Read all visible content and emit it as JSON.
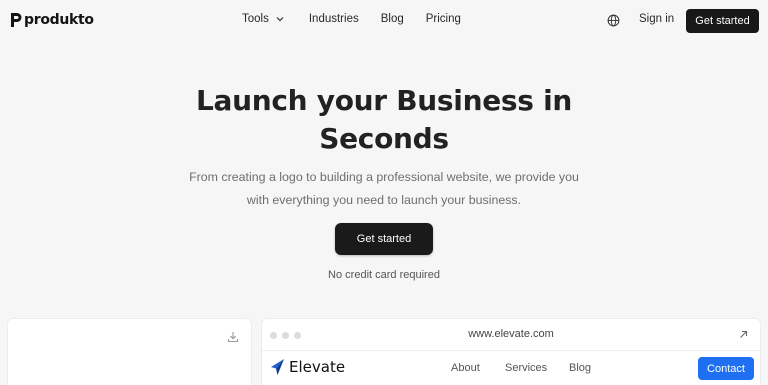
{
  "brand": {
    "name": "produkto"
  },
  "nav": {
    "links": [
      "Tools",
      "Industries",
      "Blog",
      "Pricing"
    ],
    "sign_in": "Sign in",
    "cta": "Get started"
  },
  "hero": {
    "title_line1": "Launch your Business in",
    "title_line2": "Seconds",
    "subtitle_line1": "From creating a logo to building a professional website, we provide you",
    "subtitle_line2": "with everything you need to launch your business.",
    "cta": "Get started",
    "note": "No credit card required"
  },
  "preview": {
    "url": "www.elevate.com",
    "site_name": "Elevate",
    "site_links": [
      "About",
      "Services",
      "Blog"
    ],
    "site_cta": "Contact"
  },
  "colors": {
    "background": "#f6f6f6",
    "dark_button": "#181818",
    "accent_blue": "#1f6ff2"
  },
  "icons": [
    "chevron-down-icon",
    "globe-icon",
    "download-icon",
    "external-link-icon",
    "elevate-logo-icon"
  ]
}
